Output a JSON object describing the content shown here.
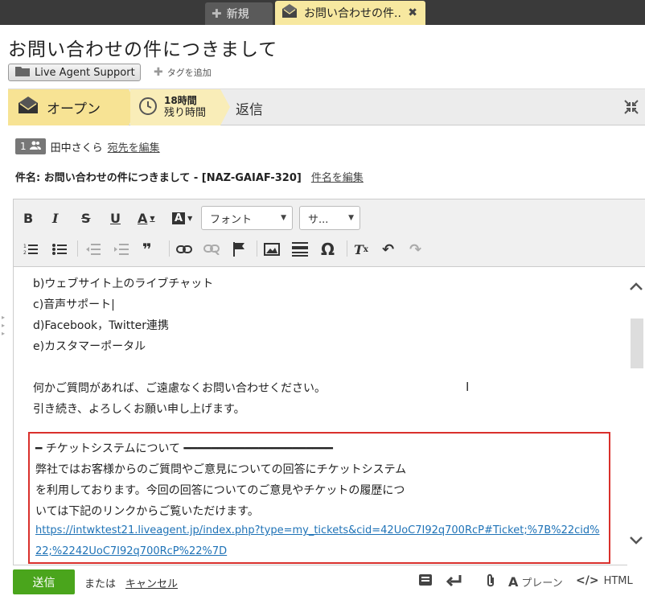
{
  "tabs": {
    "new_label": "新規",
    "active_label": "お問い合わせの件..",
    "close_glyph": "✖"
  },
  "ticket": {
    "title": "お問い合わせの件につきまして",
    "department": "Live Agent Support",
    "add_tag": "タグを追加"
  },
  "status": {
    "open_label": "オープン",
    "time_hours": "18時間",
    "time_remaining": "残り時間",
    "reply_label": "返信"
  },
  "recipients": {
    "count": "1",
    "name": "田中さくら",
    "edit_link": "宛先を編集"
  },
  "subject": {
    "text": "件名: お問い合わせの件につきまして - [NAZ-GAIAF-320]",
    "edit_link": "件名を編集"
  },
  "toolbar": {
    "font_select": "フォント",
    "size_select": "サ..."
  },
  "body": {
    "lines": [
      "b)ウェブサイト上のライブチャット",
      "c)音声サポート",
      "d)Facebook，Twitter連携",
      "e)カスタマーポータル",
      "何かご質問があれば、ご遠慮なくお問い合わせください。",
      "引き続き、よろしくお願い申し上げます。"
    ],
    "note_heading": "━  チケットシステムについて  ━━━━━━━━━━━━━━━━━━━━━━",
    "note_lines": [
      "弊社ではお客様からのご質問やご意見についての回答にチケットシステム",
      "を利用しております。今回の回答についてのご意見やチケットの履歴につ",
      "いては下記のリンクからご覧いただけます。"
    ],
    "note_link_1": "https://intwktest21.liveagent.jp/index.php?type=my_tickets&cid=42UoC7I92q700RcP#Ticket;%7B%22cid%",
    "note_link_2": "22;%2242UoC7I92q700RcP%22%7D"
  },
  "footer": {
    "send_label": "送信",
    "or_label": "または",
    "cancel_label": "キャンセル",
    "plain_label": "プレーン",
    "html_label": "HTML"
  },
  "colors": {
    "accent_yellow": "#f7e394",
    "send_green": "#4aa51c",
    "note_border": "#d9302c",
    "link_blue": "#1f73b7"
  }
}
